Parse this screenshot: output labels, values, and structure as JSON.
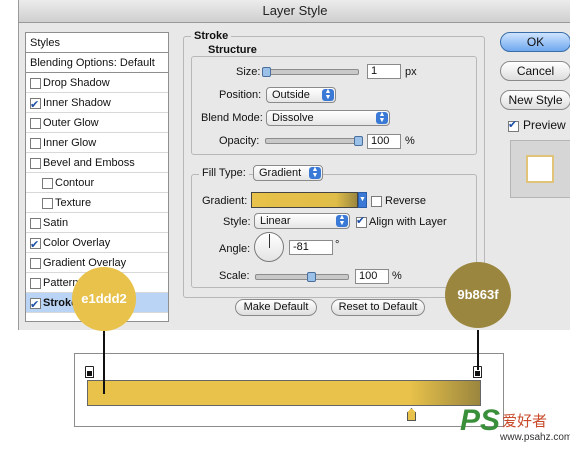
{
  "window": {
    "title": "Layer Style"
  },
  "styles_panel": {
    "header": "Styles",
    "blending": "Blending Options: Default",
    "items": [
      {
        "label": "Drop Shadow",
        "checked": false
      },
      {
        "label": "Inner Shadow",
        "checked": true
      },
      {
        "label": "Outer Glow",
        "checked": false
      },
      {
        "label": "Inner Glow",
        "checked": false
      },
      {
        "label": "Bevel and Emboss",
        "checked": false
      },
      {
        "label": "Contour",
        "checked": false
      },
      {
        "label": "Texture",
        "checked": false
      },
      {
        "label": "Satin",
        "checked": false
      },
      {
        "label": "Color Overlay",
        "checked": true
      },
      {
        "label": "Gradient Overlay",
        "checked": false
      },
      {
        "label": "Pattern",
        "checked": false
      },
      {
        "label": "Stroke",
        "checked": true
      }
    ]
  },
  "stroke": {
    "title": "Stroke",
    "structure": {
      "title": "Structure",
      "size_label": "Size:",
      "size_value": "1",
      "size_unit": "px",
      "position_label": "Position:",
      "position_value": "Outside",
      "blend_label": "Blend Mode:",
      "blend_value": "Dissolve",
      "opacity_label": "Opacity:",
      "opacity_value": "100",
      "opacity_unit": "%"
    },
    "fill": {
      "type_label": "Fill Type:",
      "type_value": "Gradient",
      "gradient_label": "Gradient:",
      "reverse_label": "Reverse",
      "reverse_checked": false,
      "style_label": "Style:",
      "style_value": "Linear",
      "align_label": "Align with Layer",
      "align_checked": true,
      "angle_label": "Angle:",
      "angle_value": "-81",
      "angle_unit": "°",
      "scale_label": "Scale:",
      "scale_value": "100",
      "scale_unit": "%"
    },
    "make_default": "Make Default",
    "reset_default": "Reset to Default"
  },
  "buttons": {
    "ok": "OK",
    "cancel": "Cancel",
    "new_style": "New Style",
    "preview": "Preview"
  },
  "annotations": {
    "left_color": "e1ddd2",
    "left_hex": "#e8c24a",
    "right_color": "9b863f",
    "right_hex": "#9b863f"
  },
  "gradient_bar": {
    "start_color": "#e8c24a",
    "end_color": "#9b863f"
  },
  "watermark": {
    "ps": "PS",
    "cn": "爱好者",
    "url": "www.psahz.com"
  }
}
